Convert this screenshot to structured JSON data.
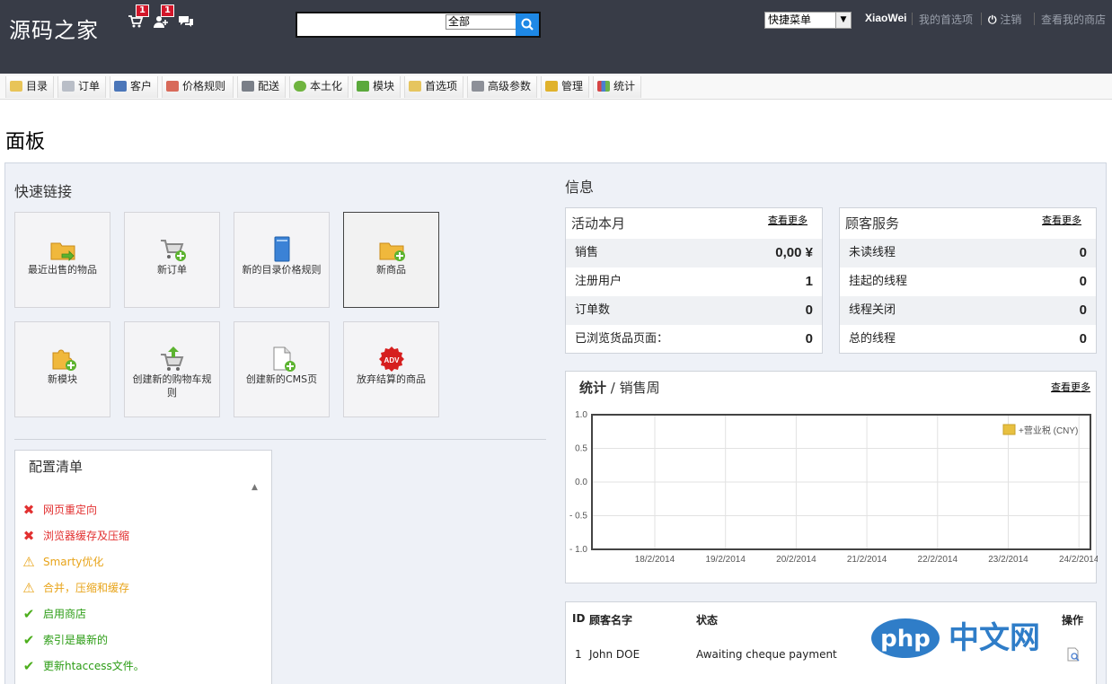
{
  "header": {
    "logo": "源码之家",
    "cart_badge": "1",
    "customers_badge": "1",
    "search_scope": "全部",
    "quick_menu": "快捷菜单",
    "user_name": "XiaoWei",
    "my_prefs": "我的首选项",
    "logout": "注销",
    "view_shop": "查看我的商店"
  },
  "nav": [
    "目录",
    "订单",
    "客户",
    "价格规则",
    "配送",
    "本土化",
    "模块",
    "首选项",
    "高级参数",
    "管理",
    "统计"
  ],
  "page_title": "面板",
  "quick_links": {
    "title": "快速链接",
    "tiles": [
      "最近出售的物品",
      "新订单",
      "新的目录价格规则",
      "新商品",
      "新模块",
      "创建新的购物车规则",
      "创建新的CMS页",
      "放弃结算的商品"
    ]
  },
  "config": {
    "title": "配置清单",
    "items": [
      {
        "label": "网页重定向",
        "status": "error"
      },
      {
        "label": "浏览器缓存及压缩",
        "status": "error"
      },
      {
        "label": "Smarty优化",
        "status": "warning"
      },
      {
        "label": "合并，压缩和缓存",
        "status": "warning"
      },
      {
        "label": "启用商店",
        "status": "ok"
      },
      {
        "label": "索引是最新的",
        "status": "ok"
      },
      {
        "label": "更新htaccess文件。",
        "status": "ok"
      }
    ]
  },
  "info": {
    "title": "信息",
    "activity": {
      "title": "活动本月",
      "more": "查看更多",
      "rows": [
        {
          "label": "销售",
          "value": "0,00 ¥"
        },
        {
          "label": "注册用户",
          "value": "1"
        },
        {
          "label": "订单数",
          "value": "0"
        },
        {
          "label": "已浏览货品页面：",
          "value": "0"
        }
      ]
    },
    "service": {
      "title": "顾客服务",
      "more": "查看更多",
      "rows": [
        {
          "label": "未读线程",
          "value": "0"
        },
        {
          "label": "挂起的线程",
          "value": "0"
        },
        {
          "label": "线程关闭",
          "value": "0"
        },
        {
          "label": "总的线程",
          "value": "0"
        }
      ]
    }
  },
  "stats": {
    "title_bold": "统计",
    "title_rest": " / 销售周",
    "more": "查看更多"
  },
  "chart_data": {
    "type": "line",
    "x": [
      "18/2/2014",
      "19/2/2014",
      "20/2/2014",
      "21/2/2014",
      "22/2/2014",
      "23/2/2014",
      "24/2/2014"
    ],
    "y_ticks": [
      "1.0",
      "0.5",
      "0.0",
      "- 0.5",
      "- 1.0"
    ],
    "series": [
      {
        "name": "+营业税 (CNY)",
        "values": [],
        "color": "#e8c040"
      }
    ],
    "ylim": [
      -1.0,
      1.0
    ],
    "grid": true,
    "legend": "top-right"
  },
  "orders": {
    "headers": [
      "ID",
      "顾客名字",
      "状态",
      "操作"
    ],
    "rows": [
      {
        "id": "1",
        "customer": "John DOE",
        "status": "Awaiting cheque payment"
      }
    ]
  },
  "watermark": "php中文网"
}
